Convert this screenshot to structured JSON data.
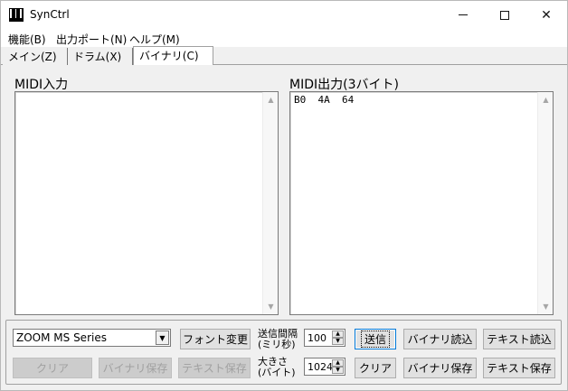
{
  "window": {
    "title": "SynCtrl"
  },
  "menu": [
    {
      "label": "機能(B)"
    },
    {
      "label": "出力ポート(N)"
    },
    {
      "label": "ヘルプ(M)"
    }
  ],
  "tabs": [
    {
      "label": "メイン(Z)"
    },
    {
      "label": "ドラム(X)"
    },
    {
      "label": "バイナリ(C)"
    }
  ],
  "midi_in": {
    "label": "MIDI入力",
    "content": ""
  },
  "midi_out": {
    "label": "MIDI出力(3バイト)",
    "content": "B0  4A  64"
  },
  "device": {
    "selected": "ZOOM MS Series"
  },
  "buttons": {
    "font_change": "フォント変更",
    "send": "送信",
    "binary_load": "バイナリ読込",
    "text_load": "テキスト読込",
    "clear_in": "クリア",
    "binary_save_in": "バイナリ保存",
    "text_save_in": "テキスト保存",
    "clear_out": "クリア",
    "binary_save_out": "バイナリ保存",
    "text_save_out": "テキスト保存"
  },
  "interval": {
    "label_line1": "送信間隔",
    "label_line2": "(ミリ秒)",
    "value": "100"
  },
  "size": {
    "label_line1": "大きさ",
    "label_line2": "(バイト)",
    "value": "1024"
  }
}
